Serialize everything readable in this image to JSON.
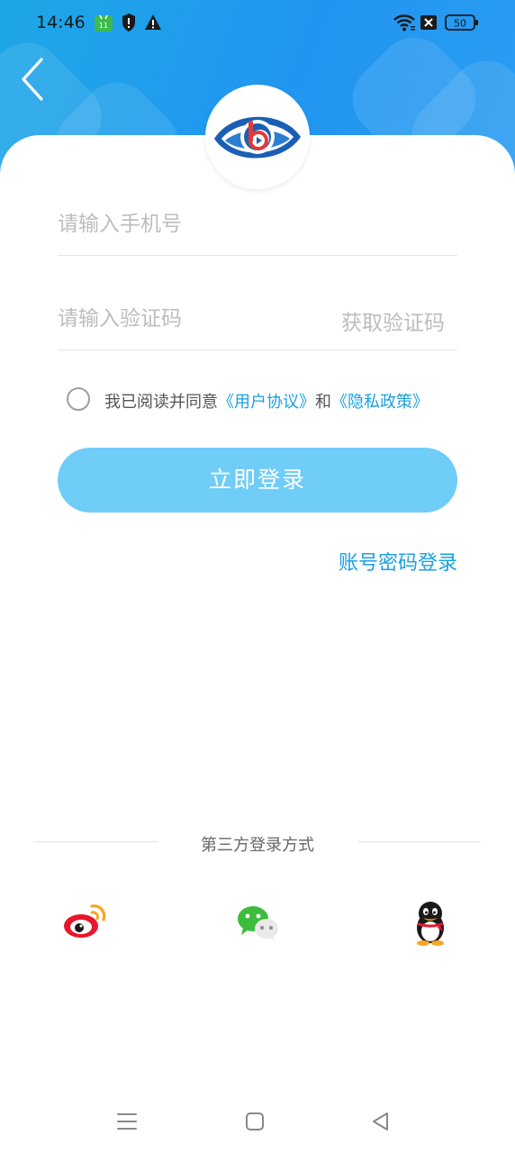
{
  "status_bar": {
    "time": "14:46",
    "battery": "50",
    "icons": [
      "app-notification-icon",
      "shield-alert-icon",
      "warning-icon",
      "wifi-icon",
      "sim-off-icon",
      "battery-icon"
    ]
  },
  "colors": {
    "header_gradient_start": "#1da7e6",
    "header_gradient_end": "#2b9cf2",
    "accent": "#1aa0e0",
    "login_button": "#6fcdf8"
  },
  "form": {
    "phone_placeholder": "请输入手机号",
    "code_placeholder": "请输入验证码",
    "get_code_label": "获取验证码",
    "agreement_prefix": "我已阅读并同意",
    "user_agreement_link": "《用户协议》",
    "agreement_and": "和",
    "privacy_policy_link": "《隐私政策》",
    "login_label": "立即登录",
    "password_login_label": "账号密码登录"
  },
  "third_party": {
    "title": "第三方登录方式",
    "providers": [
      "weibo-icon",
      "wechat-icon",
      "qq-icon"
    ]
  },
  "nav": {
    "buttons": [
      "menu-icon",
      "home-icon",
      "back-triangle-icon"
    ]
  }
}
